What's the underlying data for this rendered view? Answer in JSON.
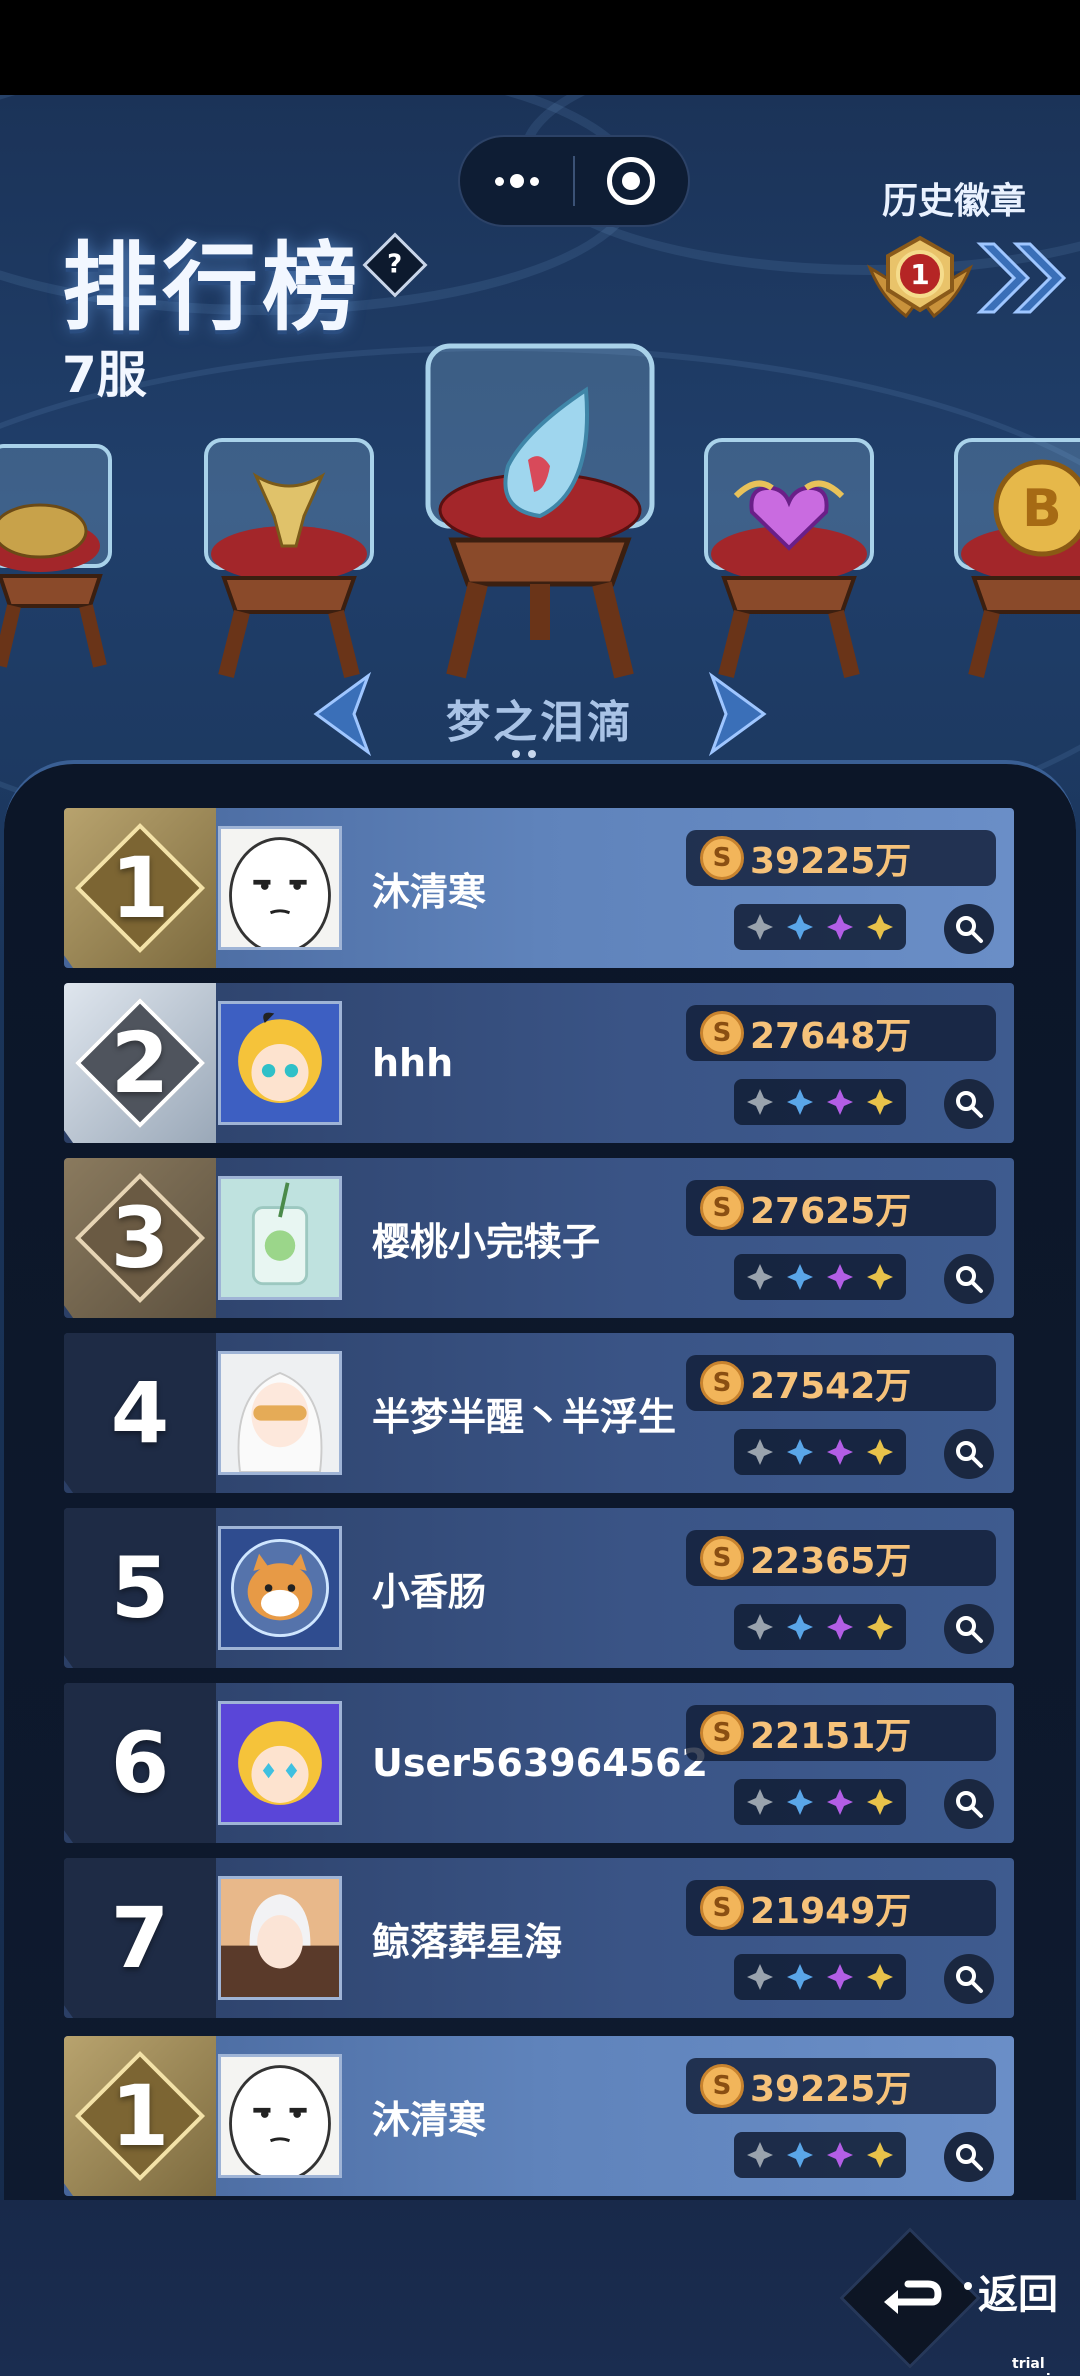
{
  "header": {
    "title": "排行榜",
    "help_symbol": "?",
    "server": "7服",
    "history_label": "历史徽章",
    "history_medal_rank": "1"
  },
  "carousel": {
    "selected_trophy": "梦之泪滴",
    "items": [
      "golden-turtle",
      "golden-trophy-cup",
      "dream-teardrop-crystal",
      "purple-heart-gem",
      "golden-bitcoin"
    ]
  },
  "rows": [
    {
      "rank": "1",
      "name": "沐清寒",
      "score": "39225万",
      "tier": "gold"
    },
    {
      "rank": "2",
      "name": "hhh",
      "score": "27648万",
      "tier": "silver"
    },
    {
      "rank": "3",
      "name": "樱桃小完犊子",
      "score": "27625万",
      "tier": "bronze"
    },
    {
      "rank": "4",
      "name": "半梦半醒丶半浮生",
      "score": "27542万",
      "tier": "plain"
    },
    {
      "rank": "5",
      "name": "小香肠",
      "score": "22365万",
      "tier": "plain"
    },
    {
      "rank": "6",
      "name": "User563964562",
      "score": "22151万",
      "tier": "plain"
    },
    {
      "rank": "7",
      "name": "鲸落葬星海",
      "score": "21949万",
      "tier": "plain"
    }
  ],
  "my_row": {
    "rank": "1",
    "name": "沐清寒",
    "score": "39225万",
    "tier": "gold"
  },
  "coin_symbol": "S",
  "footer": {
    "back_label": "返回",
    "watermark": "trial version"
  },
  "colors": {
    "accent": "#f6c27a",
    "panel": "#0e1a2f",
    "row": "#3a5486",
    "gold": "#b8a36e"
  }
}
